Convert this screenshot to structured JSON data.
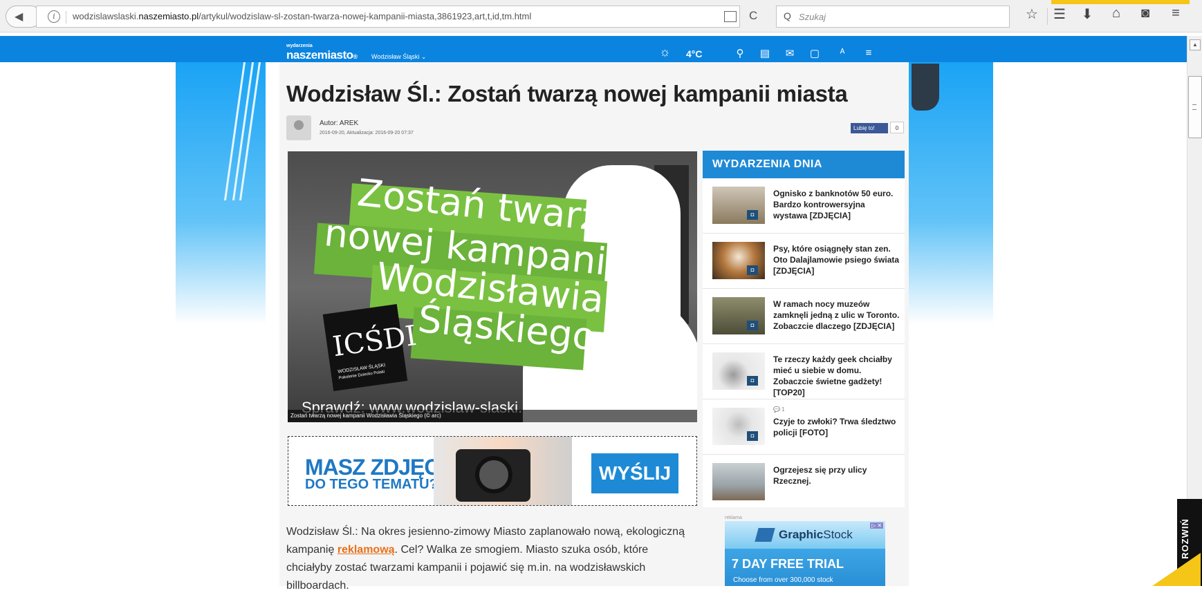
{
  "browser": {
    "url_prefix": "wodzislawslaski.",
    "url_domain": "naszemiasto.pl",
    "url_path": "/artykul/wodzislaw-sl-zostan-twarza-nowej-kampanii-miasta,3861923,art,t,id,tm.html",
    "search_placeholder": "Szukaj",
    "info_glyph": "i",
    "reload_glyph": "C",
    "search_glyph": "Q",
    "toolbar_icons": [
      "star-icon",
      "reading-list-icon",
      "download-icon",
      "home-icon",
      "pocket-icon",
      "menu-icon"
    ],
    "toolbar_glyphs": [
      "☆",
      "☰",
      "⬇",
      "⌂",
      "◙",
      "≡"
    ]
  },
  "site_nav": {
    "small_label": "wydarzenia",
    "logo": "naszemiasto",
    "logo_mark": "®",
    "city": "Wodzisław Śląski ⌄",
    "temperature": "4°C",
    "weather_glyph": "☼",
    "icons": [
      "search-icon",
      "calendar-icon",
      "mail-icon",
      "tablet-icon",
      "user-icon",
      "menu-icon"
    ],
    "icon_glyphs": [
      "⚲",
      "▤",
      "✉",
      "▢",
      "ᴬ",
      "≡"
    ]
  },
  "article": {
    "title": "Wodzisław Śl.: Zostań twarzą nowej kampanii miasta",
    "author": "Autor: AREK",
    "dates": "2016-09-20, Aktualizacja: 2016-09-20 07:37",
    "fb_like": "Lubię to!",
    "fb_count": "0",
    "image_lines": [
      "Zostań twarzą",
      "nowej kampanii",
      "Wodzisławia",
      "Śląskiego"
    ],
    "image_logo_letters": "ICŚDI",
    "image_logo_caption": "WODZISŁAW ŚLĄSKI",
    "image_logo_sub": "Pokolenie Dziecko Polski",
    "image_footer": "Sprawdź: www.wodzislaw-slaski.pl",
    "image_caption": "Zostań twarzą nowej kampanii Wodzisławia Śląskiego (© arc)",
    "body_before": "Wodzisław Śl.: Na okres jesienno-zimowy Miasto zaplanowało nową, ekologiczną kampanię ",
    "body_link": "reklamową",
    "body_after": ". Cel? Walka ze smogiem. Miasto szuka osób, które chciałyby zostać twarzami kampanii i pojawić się m.in. na wodzisławskich billboardach."
  },
  "banner": {
    "line1": "MASZ ZDJĘCIE",
    "line2": "DO TEGO TEMATU?",
    "button": "WYŚLIJ"
  },
  "sidebar": {
    "heading": "WYDARZENIA DNIA",
    "items": [
      {
        "text": "Ognisko z banknotów 50 euro. Bardzo kontrowersyjna wystawa [ZDJĘCIA]",
        "comments": "",
        "badge": true,
        "thumb": "#8a7a5e"
      },
      {
        "text": "Psy, które osiągnęły stan zen. Oto Dalajlamowie psiego świata [ZDJĘCIA]",
        "comments": "",
        "badge": true,
        "thumb": "#b5793f"
      },
      {
        "text": "W ramach nocy muzeów zamknęli jedną z ulic w Toronto. Zobaczcie dlaczego [ZDJĘCIA]",
        "comments": "",
        "badge": true,
        "thumb": "#6b6b50"
      },
      {
        "text": "Te rzeczy każdy geek chciałby mieć u siebie w domu. Zobaczcie świetne gadżety! [TOP20]",
        "comments": "",
        "badge": true,
        "thumb": "#d9d9d9"
      },
      {
        "text": "Czyje to zwłoki? Trwa śledztwo policji [FOTO]",
        "comments": "💬 1",
        "badge": true,
        "thumb": "#cfcfcf"
      },
      {
        "text": "Ogrzejesz się przy ulicy Rzecznej.",
        "comments": "",
        "badge": false,
        "thumb": "#9aa3a8"
      }
    ],
    "camera_glyph": "◘"
  },
  "ad": {
    "label": "reklama",
    "brand_bold": "Graphic",
    "brand_rest": "Stock",
    "headline": "7 DAY FREE TRIAL",
    "sub": "Choose from over 300,000 stock",
    "close": "▷ ✕"
  },
  "rozwin": "ROZWIŃ",
  "colors": {
    "nav_blue": "#0b84e0",
    "accent_blue": "#1e8ad6",
    "link_orange": "#e8701a",
    "image_green": "#7ac142"
  }
}
